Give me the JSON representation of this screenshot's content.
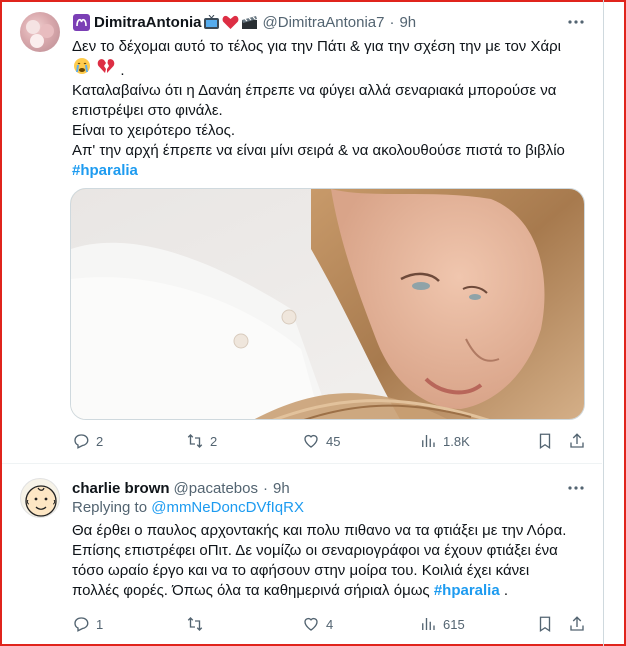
{
  "tweets": [
    {
      "author_name": "DimitraAntonia",
      "author_emojis": [
        "aries-icon",
        "tv-icon",
        "red-heart-icon",
        "clapperboard-icon"
      ],
      "handle": "@DimitraAntonia7",
      "time": "9h",
      "lines": [
        "Δεν το δέχομαι αυτό το τέλος για την Πάτι & για την σχέση την με τον Χάρι",
        "Καταλαβαίνω ότι η Δανάη έπρεπε να φύγει αλλά σεναριακά μπορούσε να",
        "επιστρέψει στο φινάλε.",
        "Είναι το χειρότερο τέλος.",
        "Απ' την αρχή έπρεπε να είναι μίνι σειρά & να ακολουθούσε πιστά το βιβλίο"
      ],
      "line1_emojis": [
        "crying-face-icon",
        "broken-heart-icon"
      ],
      "hashtag": "#hparalia",
      "media": "photo of a blonde woman lying on her side on a white surface",
      "stats": {
        "replies": "2",
        "retweets": "2",
        "likes": "45",
        "views": "1.8K"
      }
    },
    {
      "author_name": "charlie brown",
      "handle": "@pacatebos",
      "time": "9h",
      "replying_prefix": "Replying to",
      "replying_to": "@mmNeDoncDVfIqRX",
      "lines": [
        "Θα έρθει ο παυλος αρχοντακής και πολυ πιθανο να τα φτιάξει με την Λόρα.",
        "Επίσης επιστρέφει οΠιτ. Δε νομίζω οι σεναριογράφοι να έχουν φτιάξει ένα",
        "τόσο ωραίο έργο και να το αφήσουν στην μοίρα του. Κοιλιά έχει κάνει",
        "πολλές φορές. Όπως όλα τα καθημερινά σήριαλ όμως"
      ],
      "hashtag": "#hparalia",
      "trailing": ".",
      "stats": {
        "replies": "1",
        "retweets": "",
        "likes": "4",
        "views": "615"
      }
    }
  ],
  "colors": {
    "link": "#1d9bf0",
    "muted": "#536471",
    "text": "#0f1419",
    "frame": "#e0241c"
  }
}
